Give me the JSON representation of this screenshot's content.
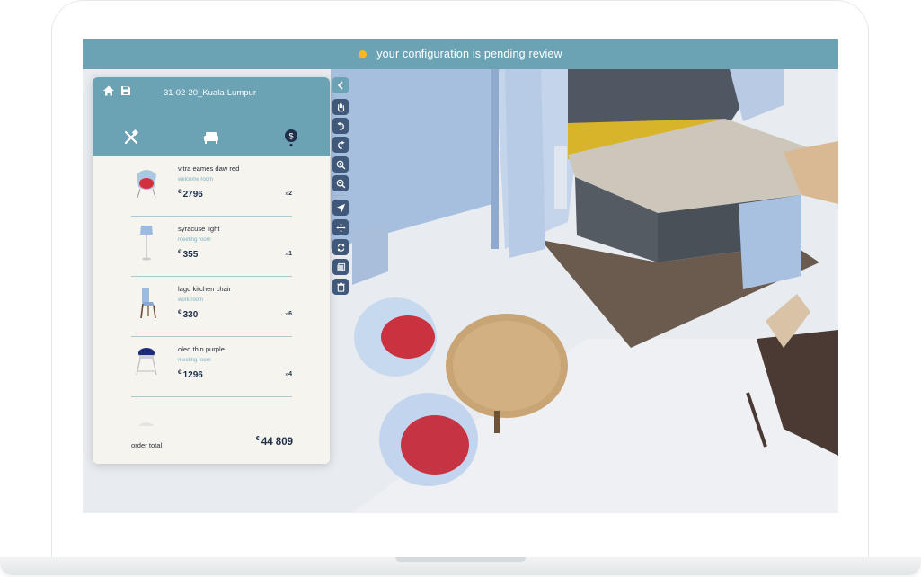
{
  "status_bar": {
    "text": "your configuration is pending review",
    "dot_color": "#f6b81c"
  },
  "panel": {
    "title": "31-02-20_Kuala-Lumpur",
    "header_icons": [
      "home-icon",
      "save-icon"
    ],
    "tabs": [
      {
        "icon": "tools-icon",
        "active": false
      },
      {
        "icon": "sofa-icon",
        "active": false
      },
      {
        "icon": "dollar-icon",
        "active": true
      }
    ],
    "items": [
      {
        "name": "vitra eames daw red",
        "room": "welcome room",
        "currency": "€",
        "price": "2796",
        "qty_prefix": "x",
        "qty": "2",
        "thumb": "red-armchair"
      },
      {
        "name": "syracuse light",
        "room": "meeting room",
        "currency": "€",
        "price": "355",
        "qty_prefix": "x",
        "qty": "1",
        "thumb": "floor-lamp"
      },
      {
        "name": "lago kitchen chair",
        "room": "work room",
        "currency": "€",
        "price": "330",
        "qty_prefix": "x",
        "qty": "6",
        "thumb": "wooden-chair"
      },
      {
        "name": "oleo thin purple",
        "room": "meeting room",
        "currency": "€",
        "price": "1296",
        "qty_prefix": "x",
        "qty": "4",
        "thumb": "bar-stool"
      }
    ],
    "total": {
      "label": "order total",
      "currency": "€",
      "value": "44 809"
    }
  },
  "toolbar": {
    "tools": [
      "chevron-left-icon",
      "hand-icon",
      "undo-icon",
      "redo-icon",
      "zoom-in-icon",
      "zoom-out-icon",
      "cursor-icon",
      "move-icon",
      "rotate-icon",
      "layers-icon",
      "trash-icon"
    ]
  },
  "colors": {
    "accent": "#6ba3b5",
    "toolbar": "#40587a",
    "panel_bg": "#f5f4ef",
    "price": "#1f2f4a"
  }
}
